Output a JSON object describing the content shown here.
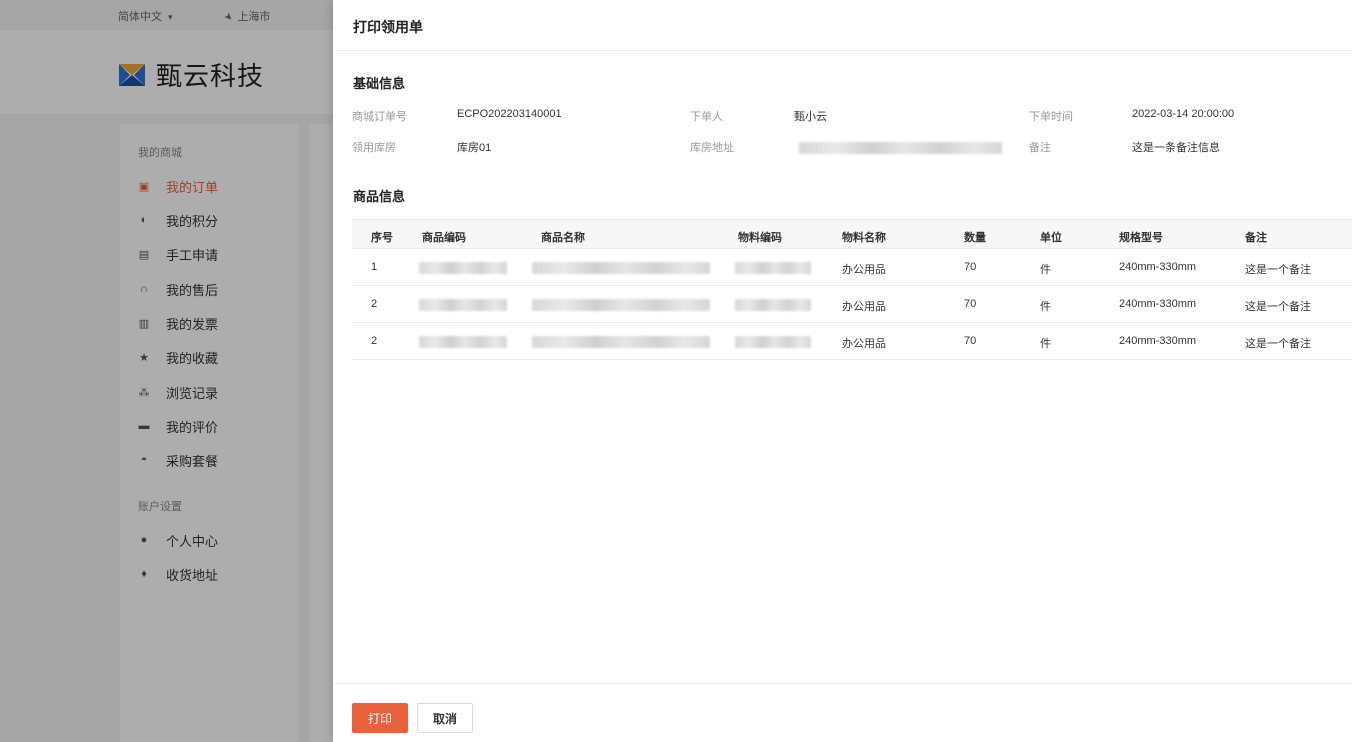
{
  "topbar": {
    "language": "简体中文",
    "city": "上海市"
  },
  "brand": {
    "name": "甄云科技"
  },
  "sidebar": {
    "groups": [
      {
        "title": "我的商城",
        "items": [
          {
            "label": "我的订单",
            "icon": "clipboard-icon",
            "active": true
          },
          {
            "label": "我的积分",
            "icon": "coin-icon"
          },
          {
            "label": "手工申请",
            "icon": "form-icon"
          },
          {
            "label": "我的售后",
            "icon": "headset-icon"
          },
          {
            "label": "我的发票",
            "icon": "invoice-icon"
          },
          {
            "label": "我的收藏",
            "icon": "star-icon"
          },
          {
            "label": "浏览记录",
            "icon": "footprint-icon"
          },
          {
            "label": "我的评价",
            "icon": "comment-icon"
          },
          {
            "label": "采购套餐",
            "icon": "basket-icon"
          }
        ]
      },
      {
        "title": "账户设置",
        "items": [
          {
            "label": "个人中心",
            "icon": "user-icon"
          },
          {
            "label": "收货地址",
            "icon": "location-icon"
          }
        ]
      }
    ]
  },
  "drawer": {
    "title": "打印领用单",
    "basic": {
      "title": "基础信息",
      "fields": {
        "order_no_label": "商城订单号",
        "order_no": "ECPO202203140001",
        "orderer_label": "下单人",
        "orderer": "甄小云",
        "order_time_label": "下单时间",
        "order_time": "2022-03-14 20:00:00",
        "warehouse_label": "领用库房",
        "warehouse": "库房01",
        "warehouse_addr_label": "库房地址",
        "remark_label": "备注",
        "remark": "这是一条备注信息"
      }
    },
    "goods": {
      "title": "商品信息",
      "columns": [
        "序号",
        "商品编码",
        "商品名称",
        "物料编码",
        "物料名称",
        "数量",
        "单位",
        "规格型号",
        "备注"
      ],
      "rows": [
        {
          "no": "1",
          "material_name": "办公用品",
          "qty": "70",
          "unit": "件",
          "spec": "240mm-330mm",
          "remark": "这是一个备注"
        },
        {
          "no": "2",
          "material_name": "办公用品",
          "qty": "70",
          "unit": "件",
          "spec": "240mm-330mm",
          "remark": "这是一个备注"
        },
        {
          "no": "2",
          "material_name": "办公用品",
          "qty": "70",
          "unit": "件",
          "spec": "240mm-330mm",
          "remark": "这是一个备注"
        }
      ]
    },
    "buttons": {
      "print": "打印",
      "cancel": "取消"
    }
  },
  "colors": {
    "accent": "#e8613c",
    "overlay": "rgba(0,0,0,0.32)"
  }
}
